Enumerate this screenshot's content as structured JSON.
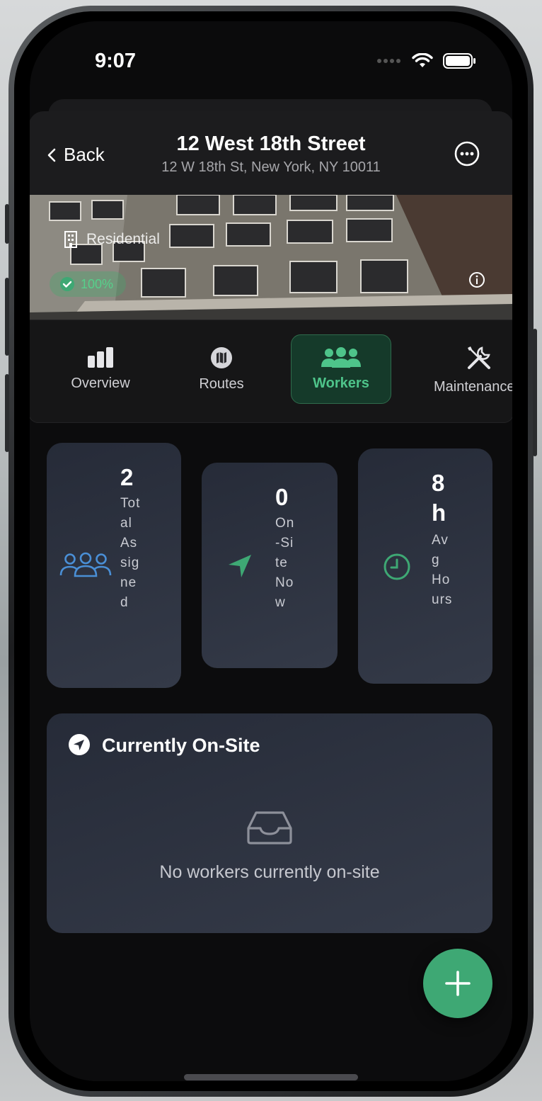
{
  "status_bar": {
    "time": "9:07"
  },
  "navbar": {
    "back_label": "Back",
    "title": "12 West 18th Street",
    "subtitle": "12 W 18th St, New York, NY 10011"
  },
  "hero": {
    "type_label": "Residential",
    "badge": "100%"
  },
  "tabs": [
    {
      "label": "Overview",
      "icon": "bar-chart-icon"
    },
    {
      "label": "Routes",
      "icon": "map-icon"
    },
    {
      "label": "Workers",
      "icon": "people-icon",
      "active": true
    },
    {
      "label": "Maintenance",
      "icon": "wrench-screwdriver-icon"
    }
  ],
  "stats": [
    {
      "value": "2",
      "label": "Total Assigned",
      "icon": "people-icon",
      "color": "#4a8fd6"
    },
    {
      "value": "0",
      "label": "On-Site Now",
      "icon": "location-arrow-icon",
      "color": "#3ea874"
    },
    {
      "value": "8h",
      "label": "Avg Hours",
      "icon": "clock-icon",
      "color": "#3ea874"
    }
  ],
  "onsite": {
    "title": "Currently On-Site",
    "empty_text": "No workers currently on-site"
  },
  "colors": {
    "accent": "#3ea874",
    "active_tab_bg": "#153a2a",
    "card_bg": "#2e3442"
  }
}
